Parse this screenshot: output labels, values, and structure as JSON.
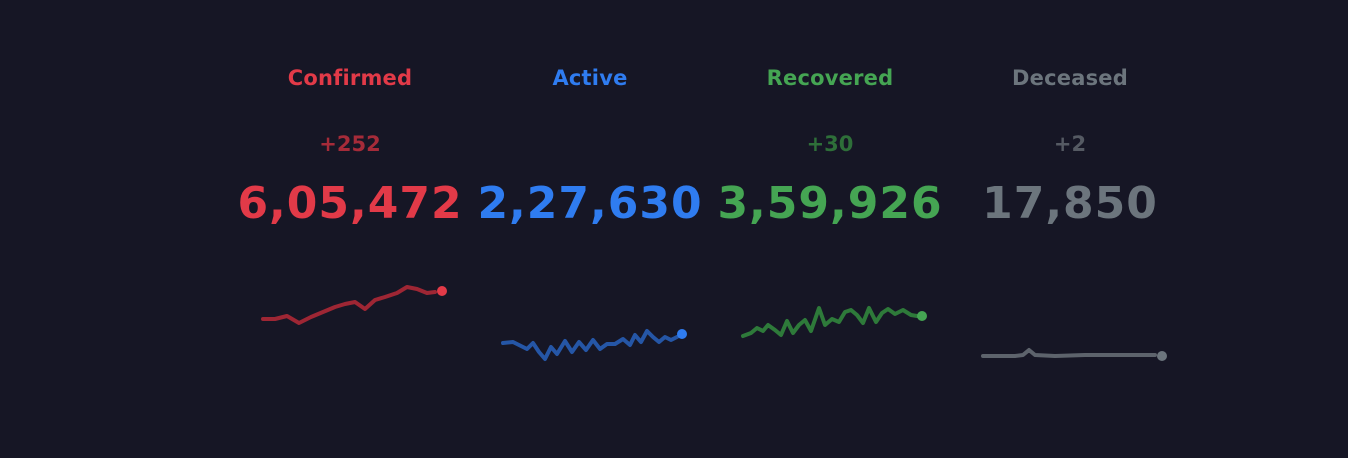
{
  "stats": [
    {
      "key": "confirmed",
      "label": "Confirmed",
      "delta": "+252",
      "value": "6,05,472",
      "color": "#e23a48",
      "delta_color": "#a52b39",
      "line_color": "#9e2634",
      "dot_color": "#e23a48"
    },
    {
      "key": "active",
      "label": "Active",
      "delta": "",
      "value": "2,27,630",
      "color": "#2f7cf0",
      "delta_color": "#2f7cf0",
      "line_color": "#2556a6",
      "dot_color": "#2f7cf0"
    },
    {
      "key": "recovered",
      "label": "Recovered",
      "delta": "+30",
      "value": "3,59,926",
      "color": "#45a553",
      "delta_color": "#2e6f39",
      "line_color": "#2e7a3a",
      "dot_color": "#45a553"
    },
    {
      "key": "deceased",
      "label": "Deceased",
      "delta": "+2",
      "value": "17,850",
      "color": "#6c757d",
      "delta_color": "#555a63",
      "line_color": "#5d636c",
      "dot_color": "#6c757d"
    }
  ]
}
